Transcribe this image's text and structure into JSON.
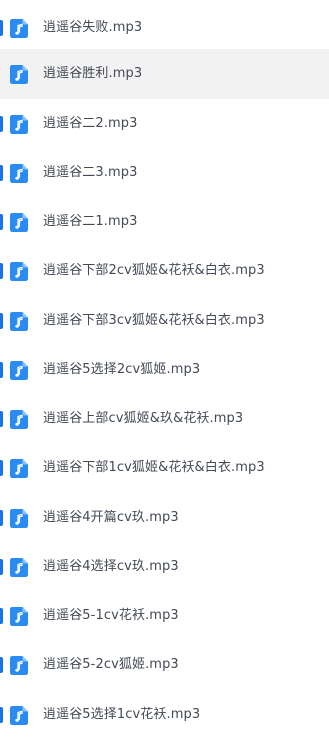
{
  "files": [
    {
      "name": "逍遥谷失败.mp3",
      "selected": false,
      "icon": "audio-file-icon"
    },
    {
      "name": "逍遥谷胜利.mp3",
      "selected": true,
      "icon": "audio-file-icon"
    },
    {
      "name": "逍遥谷二2.mp3",
      "selected": false,
      "icon": "audio-file-icon"
    },
    {
      "name": "逍遥谷二3.mp3",
      "selected": false,
      "icon": "audio-file-icon"
    },
    {
      "name": "逍遥谷二1.mp3",
      "selected": false,
      "icon": "audio-file-icon"
    },
    {
      "name": "逍遥谷下部2cv狐姬&花袄&白衣.mp3",
      "selected": false,
      "icon": "audio-file-icon"
    },
    {
      "name": "逍遥谷下部3cv狐姬&花袄&白衣.mp3",
      "selected": false,
      "icon": "audio-file-icon"
    },
    {
      "name": "逍遥谷5选择2cv狐姬.mp3",
      "selected": false,
      "icon": "audio-file-icon"
    },
    {
      "name": "逍遥谷上部cv狐姬&玖&花袄.mp3",
      "selected": false,
      "icon": "audio-file-icon"
    },
    {
      "name": "逍遥谷下部1cv狐姬&花袄&白衣.mp3",
      "selected": false,
      "icon": "audio-file-icon"
    },
    {
      "name": "逍遥谷4开篇cv玖.mp3",
      "selected": false,
      "icon": "audio-file-icon"
    },
    {
      "name": "逍遥谷4选择cv玖.mp3",
      "selected": false,
      "icon": "audio-file-icon"
    },
    {
      "name": "逍遥谷5-1cv花袄.mp3",
      "selected": false,
      "icon": "audio-file-icon"
    },
    {
      "name": "逍遥谷5-2cv狐姬.mp3",
      "selected": false,
      "icon": "audio-file-icon"
    },
    {
      "name": "逍遥谷5选择1cv花袄.mp3",
      "selected": false,
      "icon": "audio-file-icon"
    }
  ],
  "colors": {
    "icon_blue": "#2a8cf2",
    "accent": "#1a73e8",
    "selected_bg": "#f2f2f3",
    "text": "#444a55"
  }
}
